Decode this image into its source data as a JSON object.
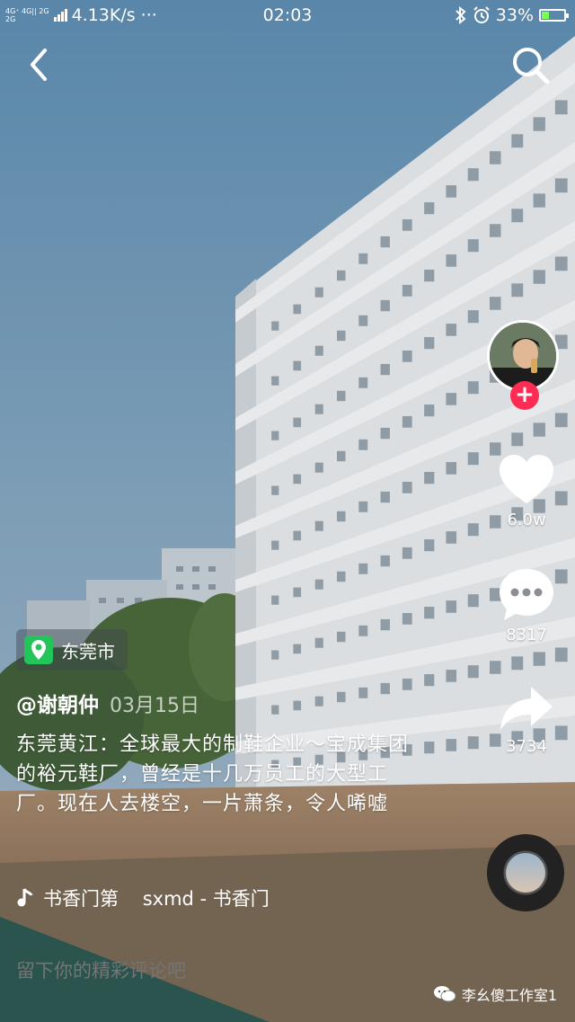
{
  "status_bar": {
    "net_top": "4G⁺ 4G|| 2G",
    "net_bottom": "2G",
    "speed": "4.13K/s",
    "more": "···",
    "time": "02:03",
    "battery_percent": "33%",
    "battery_level": 0.33,
    "battery_color": "#7dff4f"
  },
  "nav": {
    "back_icon": "chevron-left-icon",
    "search_icon": "search-icon"
  },
  "sidebar": {
    "follow_label": "+",
    "likes_count": "6.0w",
    "comments_count": "8317",
    "shares_count": "3734"
  },
  "post": {
    "location": "东莞市",
    "author": "@谢朝仲",
    "date": "03月15日",
    "caption": "东莞黄江：全球最大的制鞋企业～宝成集团的裕元鞋厂，曾经是十几万员工的大型工厂。现在人去楼空，一片萧条，令人唏嘘"
  },
  "music": {
    "title": "书香门第    sxmd - 书香门"
  },
  "comment_box": {
    "placeholder": "留下你的精彩评论吧"
  },
  "watermark": {
    "text": "李幺傻工作室1"
  },
  "colors": {
    "accent": "#fe2c55",
    "location_green": "#23c45a"
  }
}
